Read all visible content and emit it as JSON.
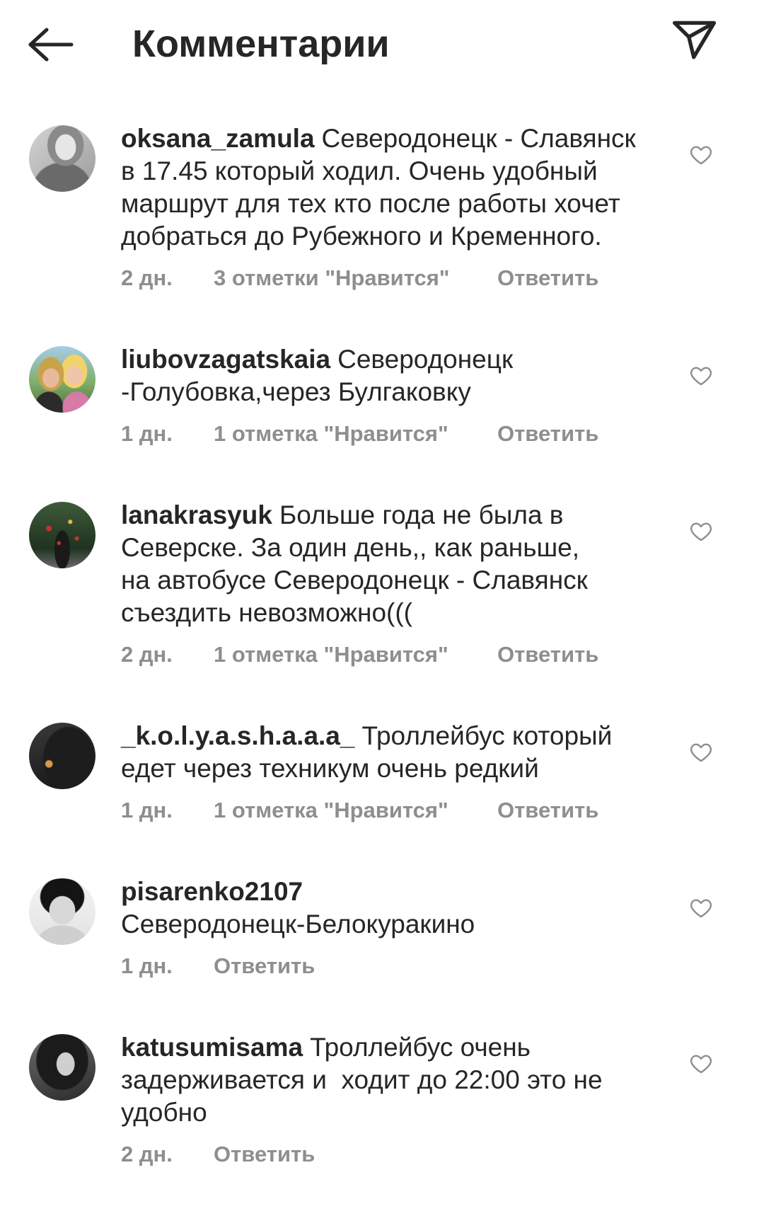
{
  "header": {
    "title": "Комментарии",
    "back_icon": "arrow-left-icon",
    "direct_icon": "paper-plane-icon"
  },
  "colors": {
    "text": "#262626",
    "secondary": "#8e8e8e",
    "background": "#ffffff"
  },
  "comment_like_icon": "heart-outline-icon",
  "comments": [
    {
      "username": "oksana_zamula",
      "text_lines": [
        "Северодонецк - Славянск",
        "в 17.45 который ходил. Очень удобный",
        "маршрут для тех кто после работы хочет",
        "добраться до Рубежного и Кременного."
      ],
      "time": "2 дн.",
      "likes": "3 отметки \"Нравится\"",
      "reply": "Ответить"
    },
    {
      "username": "liubovzagatskaia",
      "text_lines": [
        "Северодонецк",
        "-Голубовка,через Булгаковку"
      ],
      "time": "1 дн.",
      "likes": "1 отметка \"Нравится\"",
      "reply": "Ответить"
    },
    {
      "username": "lanakrasyuk",
      "text_lines": [
        "Больше года не была в",
        "Северске. За один день,, как раньше,",
        "на автобусе Северодонецк - Славянск",
        "съездить невозможно((("
      ],
      "time": "2 дн.",
      "likes": "1 отметка \"Нравится\"",
      "reply": "Ответить"
    },
    {
      "username": "_k.o.l.y.a.s.h.a.a.a_",
      "text_lines": [
        "Троллейбус который",
        "едет через техникум очень редкий"
      ],
      "time": "1 дн.",
      "likes": "1 отметка \"Нравится\"",
      "reply": "Ответить"
    },
    {
      "username": "pisarenko2107",
      "text_lines": [
        "Северодонецк-Белокуракино"
      ],
      "time": "1 дн.",
      "reply": "Ответить"
    },
    {
      "username": "katusumisama",
      "text_lines": [
        "Троллейбус очень",
        "задерживается и  ходит до 22:00 это не",
        "удобно"
      ],
      "time": "2 дн.",
      "reply": "Ответить"
    }
  ]
}
